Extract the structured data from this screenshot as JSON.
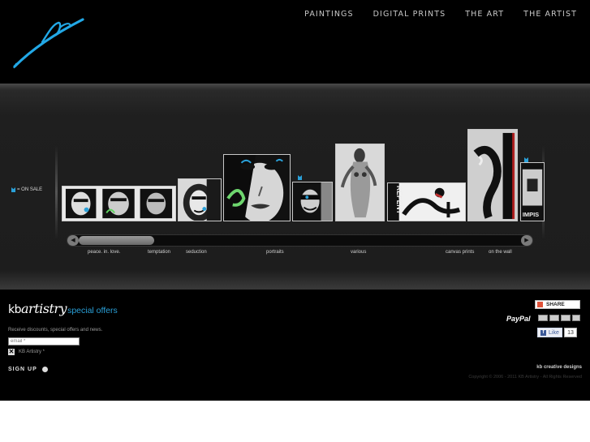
{
  "nav": {
    "items": [
      {
        "label": "PAINTINGS"
      },
      {
        "label": "DIGITAL PRINTS"
      },
      {
        "label": "THE ART"
      },
      {
        "label": "THE ARTIST"
      }
    ]
  },
  "gallery": {
    "on_sale_label": "= ON SALE",
    "categories": [
      {
        "label": "peace. in. love."
      },
      {
        "label": "temptation"
      },
      {
        "label": "seduction"
      },
      {
        "label": "portraits"
      },
      {
        "label": "various"
      },
      {
        "label": "canvas prints"
      },
      {
        "label": "on the wall"
      }
    ],
    "art_text": {
      "repent": "REPENT",
      "impis": "IMPIS"
    },
    "scroll_left": "◀",
    "scroll_right": "▶"
  },
  "footer": {
    "logo_text": "kb",
    "logo_script": "artistry",
    "logo_offer": "special offers",
    "receive_text": "Receive discounts, special offers and news.",
    "email_placeholder": "email *",
    "checkbox_label": "KB Artistry *",
    "signup_label": "SIGN UP",
    "share_label": "SHARE",
    "paypal_label": "PayPal",
    "like_label": "Like",
    "like_count": "13",
    "credit": "kb creative designs",
    "copyright": "Copyright © 2006 - 2011 KB Artistry - All Rights Reserved"
  },
  "colors": {
    "accent": "#2aa0d8",
    "background": "#000000"
  }
}
